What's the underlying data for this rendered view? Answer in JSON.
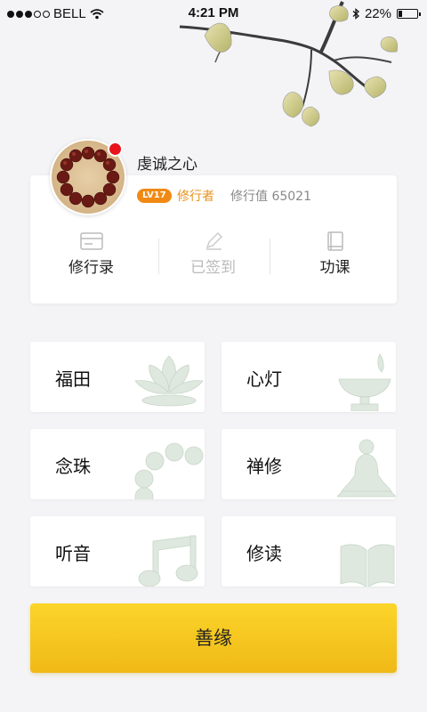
{
  "status_bar": {
    "carrier": "BELL",
    "time": "4:21 PM",
    "battery": "22%",
    "battery_level": 0.22
  },
  "profile": {
    "username": "虔诚之心",
    "level": "LV17",
    "rank": "修行者",
    "practice_value_label": "修行值 65021"
  },
  "actions": [
    {
      "label": "修行录",
      "icon": "card-icon"
    },
    {
      "label": "已签到",
      "icon": "pencil-icon"
    },
    {
      "label": "功课",
      "icon": "book-icon"
    }
  ],
  "tiles": [
    {
      "label": "福田",
      "icon": "lotus-icon"
    },
    {
      "label": "心灯",
      "icon": "lamp-icon"
    },
    {
      "label": "念珠",
      "icon": "beads-icon"
    },
    {
      "label": "禅修",
      "icon": "meditation-icon"
    },
    {
      "label": "听音",
      "icon": "music-note-icon"
    },
    {
      "label": "修读",
      "icon": "open-book-icon"
    }
  ],
  "main_button": {
    "label": "善缘"
  },
  "colors": {
    "accent_orange": "#f08a14",
    "button_yellow": "#f7c81f",
    "notification_red": "#e8131d"
  }
}
